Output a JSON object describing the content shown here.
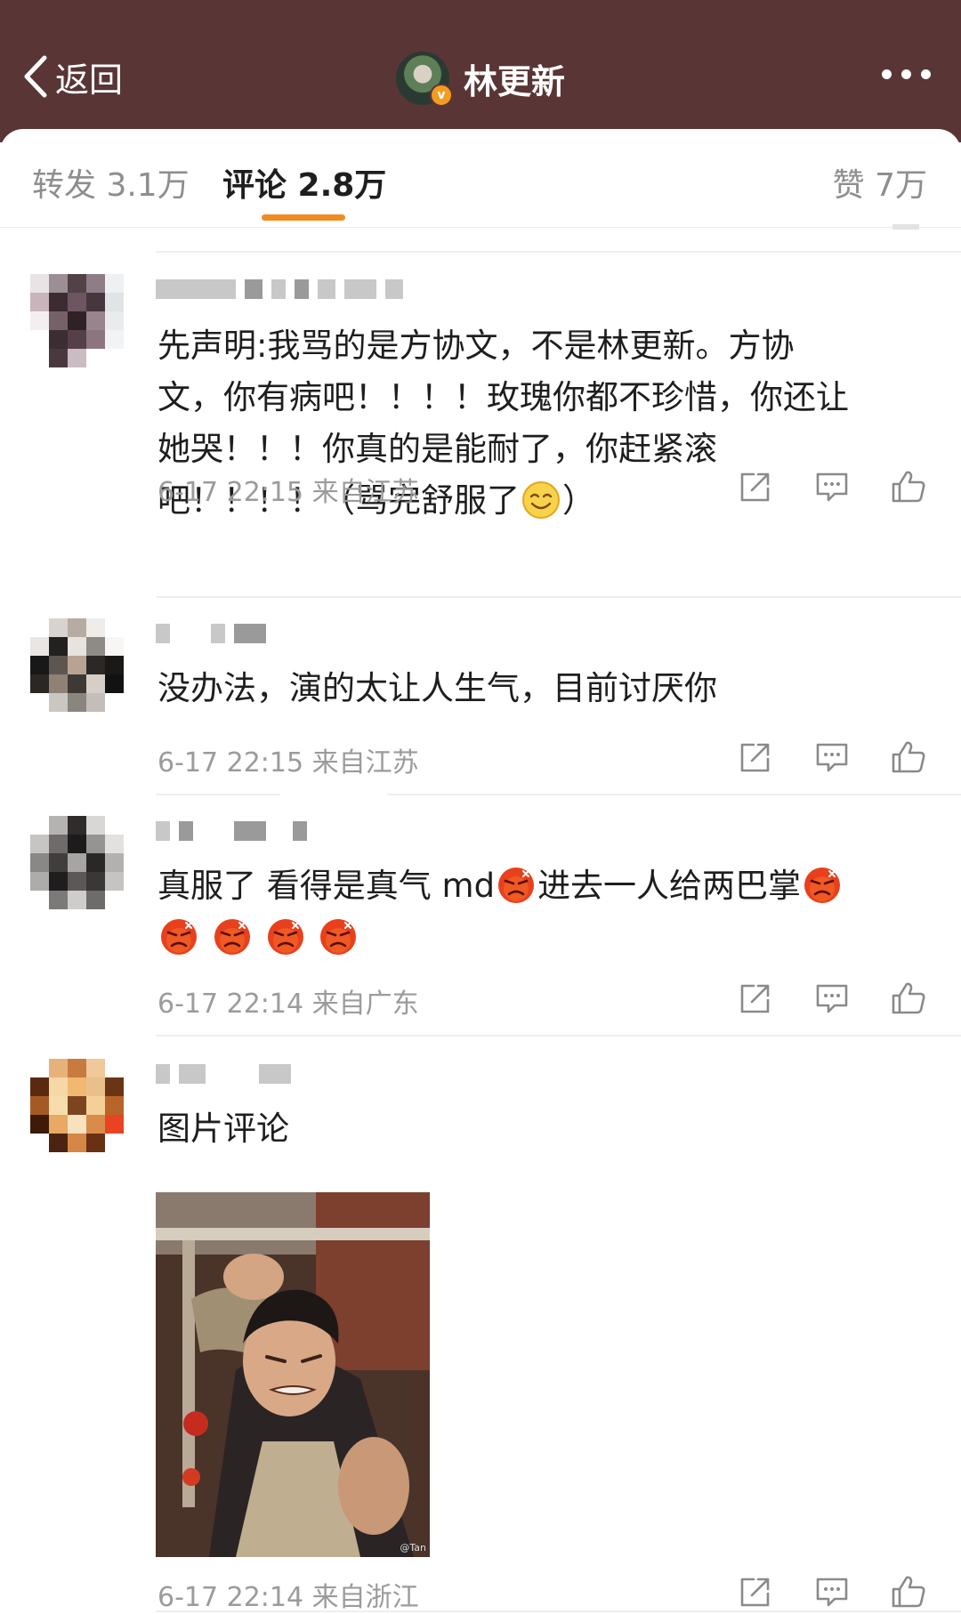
{
  "header": {
    "back_label": "返回",
    "title": "林更新",
    "verified_badge": "v",
    "background": "#5a3535"
  },
  "tabs": {
    "reposts": "转发 3.1万",
    "comments": "评论 2.8万",
    "likes": "赞 7万",
    "indicator_color": "#f08a24"
  },
  "comments": [
    {
      "text_lines": [
        "先声明:我骂的是方协文，不是林更新。方协",
        "文，你有病吧！！！！玫瑰你都不珍惜，你还让",
        "她哭！！！你真的是能耐了，你赶紧滚",
        "吧！！！！（骂完舒服了",
        "）"
      ],
      "emoji": [
        "smile-emoji"
      ],
      "meta": "6-17 22:15 来自江苏"
    },
    {
      "text": "没办法，演的太让人生气，目前讨厌你",
      "meta": "6-17 22:15 来自江苏"
    },
    {
      "text_a": "真服了 看得是真气 md",
      "text_b": "进去一人给两巴掌",
      "emoji": [
        "angry-emoji",
        "angry-emoji",
        "angry-emoji",
        "angry-emoji",
        "angry-emoji",
        "angry-emoji"
      ],
      "meta": "6-17 22:14 来自广东"
    },
    {
      "text": "图片评论",
      "image_watermark": "@Tan",
      "meta": "6-17 22:14 来自浙江"
    }
  ],
  "icons": {
    "share": "share-icon",
    "reply": "comment-icon",
    "like": "thumbs-up-icon",
    "back": "chevron-left-icon",
    "more": "more-dots-icon"
  }
}
